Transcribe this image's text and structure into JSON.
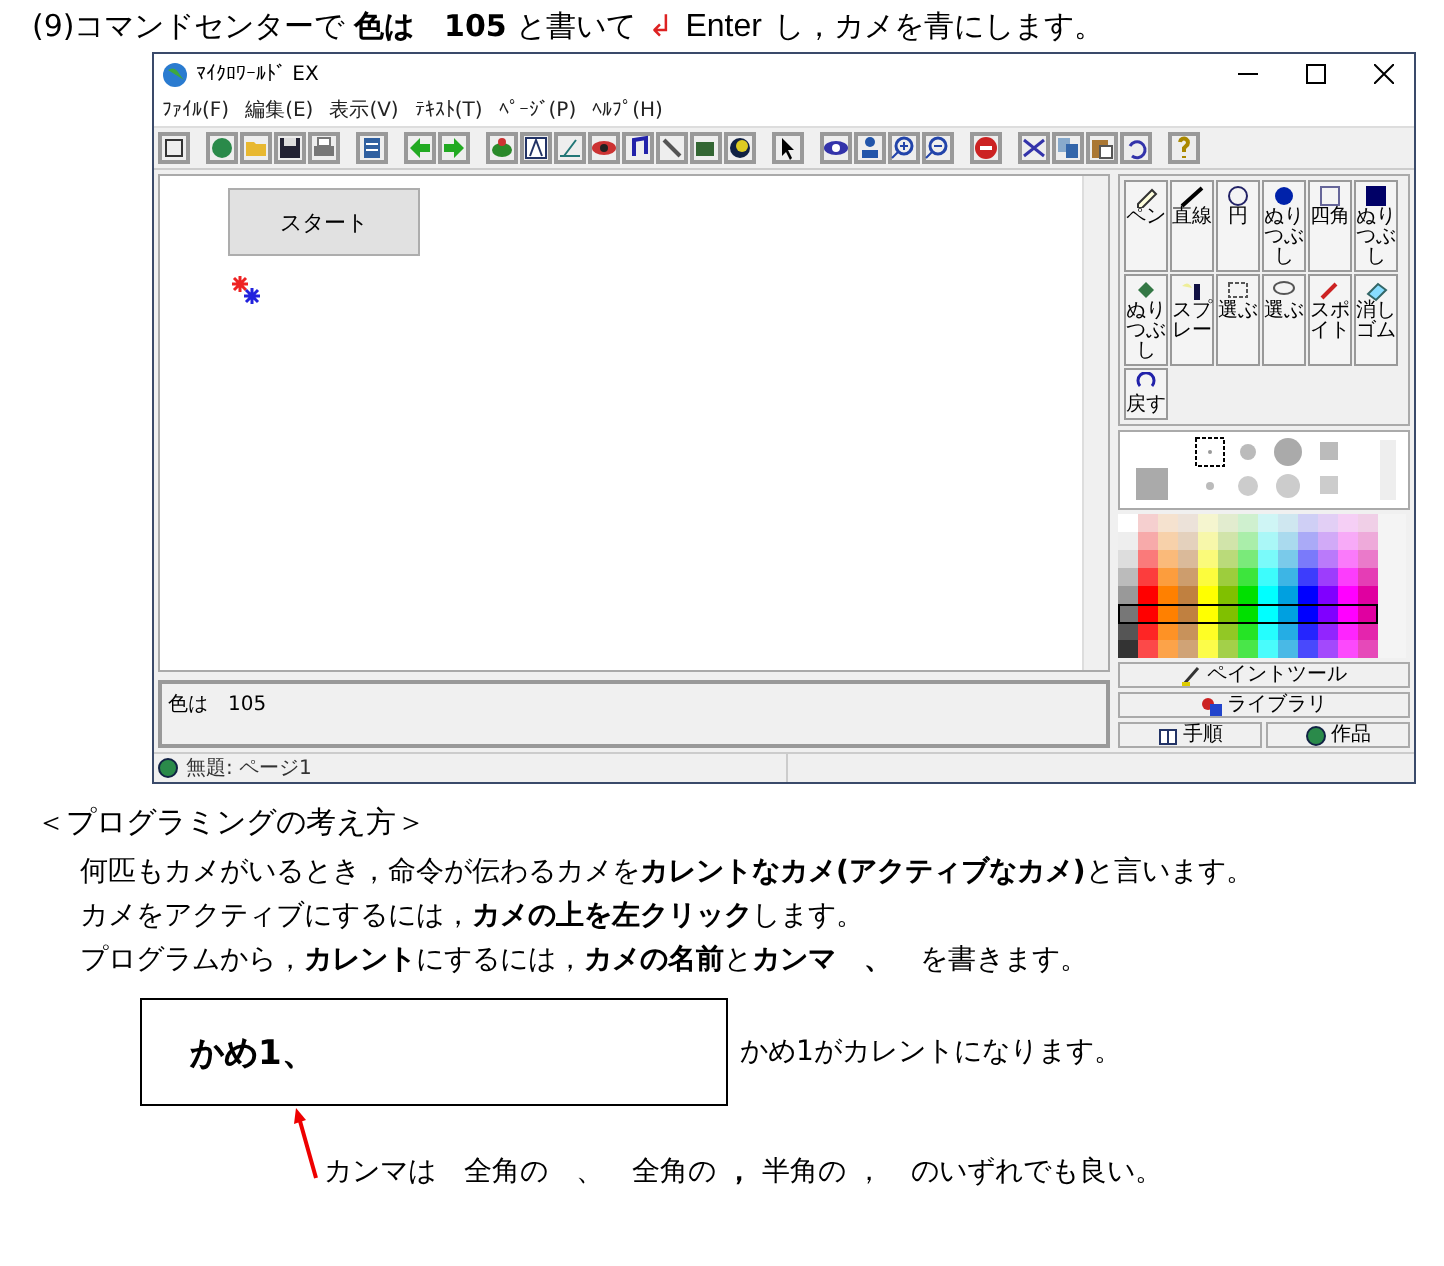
{
  "heading": {
    "text": "(9)コマンドセンターで **色は　105** と書いて",
    "enter_symbol": "↲",
    "key": "Enter",
    "rest": "し，カメを青にします。"
  },
  "window": {
    "title": "ﾏｲｸﾛﾜｰﾙﾄﾞ EX",
    "menu": [
      "ﾌｧｲﾙ(F)",
      "編集(E)",
      "表示(V)",
      "ﾃｷｽﾄ(T)",
      "ﾍﾟｰｼﾞ(P)",
      "ﾍﾙﾌﾟ(H)"
    ],
    "start_button": "スタート",
    "paint_tools": [
      {
        "label": "ペン"
      },
      {
        "label": "直線"
      },
      {
        "label": "円"
      },
      {
        "label": "ぬりつぶし"
      },
      {
        "label": "四角"
      },
      {
        "label": "ぬりつぶし"
      },
      {
        "label": "ぬりつぶし"
      },
      {
        "label": "スプレー"
      },
      {
        "label": "選ぶ"
      },
      {
        "label": "選ぶ"
      },
      {
        "label": "スポイト"
      },
      {
        "label": "消しゴム"
      },
      {
        "label": "戻す"
      }
    ],
    "panel_buttons": [
      "ペイントツール",
      "ライブラリ"
    ],
    "nav_buttons": [
      "手順",
      "作品"
    ],
    "command": {
      "value": "色は　105"
    },
    "status": "無題: ページ1"
  },
  "section_title": "＜プログラミングの考え方＞",
  "paragraphs": [
    "何匹もカメがいるとき，命令が伝わるカメを**カレントなカメ(アクティブなカメ)**と言います。",
    "カメをアクティブにするには，**カメの上を左クリック**します。",
    "プログラムから，**カレント**にするには，**カメの名前**と**カンマ　、**　を書きます。"
  ],
  "example": {
    "code": "かめ1、",
    "caption": "かめ1がカレントになります。"
  },
  "note": "カンマは　全角の　、　全角の **，** 半角の ，　のいずれでも良い。"
}
